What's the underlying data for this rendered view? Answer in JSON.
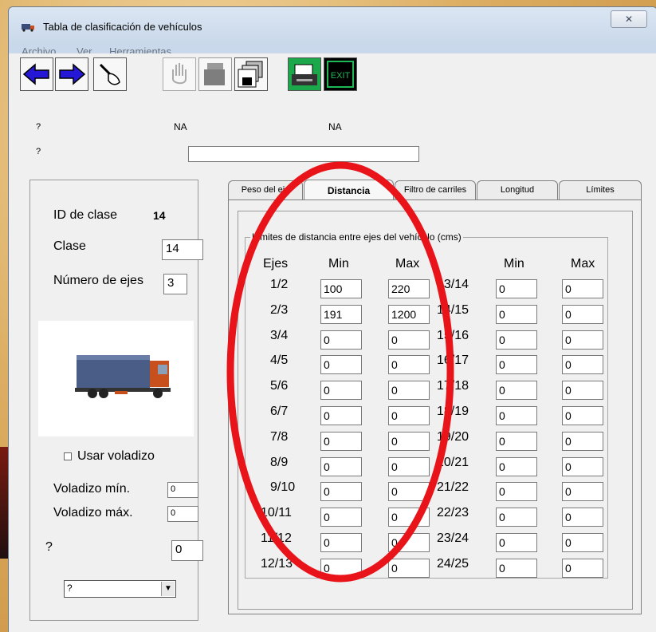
{
  "window": {
    "title": "Tabla de clasificación de vehículos",
    "close_glyph": "✕"
  },
  "menu": [
    "Archivo",
    "Ver",
    "Herramientas"
  ],
  "toolbar": {
    "exit_label": "EXIT",
    "icons": [
      "arrow-left-icon",
      "arrow-right-icon",
      "pen-hand-icon",
      "hand-icon",
      "copy-icon",
      "save-copies-icon",
      "printer-icon",
      "exit-icon"
    ]
  },
  "header": {
    "q1": "?",
    "q2": "?",
    "na1": "NA",
    "na2": "NA",
    "input_value": ""
  },
  "left": {
    "id_label": "ID de clase",
    "id_value": "14",
    "clase_label": "Clase",
    "clase_value": "14",
    "ejes_label": "Número de ejes",
    "ejes_value": "3",
    "usar_voladizo": "Usar voladizo",
    "voladizo_min_label": "Voladizo mín.",
    "voladizo_min_value": "0",
    "voladizo_max_label": "Voladizo máx.",
    "voladizo_max_value": "0",
    "q_label": "?",
    "q_value": "0",
    "select_value": "?"
  },
  "tabs": [
    {
      "label": "Peso del eje",
      "active": false
    },
    {
      "label": "Distancia",
      "active": true
    },
    {
      "label": "Filtro de carriles",
      "active": false
    },
    {
      "label": "Longitud",
      "active": false
    },
    {
      "label": "Límites",
      "active": false
    }
  ],
  "distance": {
    "group_title": "Límites de distancia entre ejes del vehículo (cms)",
    "headers": {
      "ejes": "Ejes",
      "min": "Min",
      "max": "Max",
      "min2": "Min",
      "max2": "Max"
    },
    "left_rows": [
      {
        "label": "1/2",
        "min": "100",
        "max": "220"
      },
      {
        "label": "2/3",
        "min": "191",
        "max": "1200"
      },
      {
        "label": "3/4",
        "min": "0",
        "max": "0"
      },
      {
        "label": "4/5",
        "min": "0",
        "max": "0"
      },
      {
        "label": "5/6",
        "min": "0",
        "max": "0"
      },
      {
        "label": "6/7",
        "min": "0",
        "max": "0"
      },
      {
        "label": "7/8",
        "min": "0",
        "max": "0"
      },
      {
        "label": "8/9",
        "min": "0",
        "max": "0"
      },
      {
        "label": "9/10",
        "min": "0",
        "max": "0"
      },
      {
        "label": "10/11",
        "min": "0",
        "max": "0"
      },
      {
        "label": "11/12",
        "min": "0",
        "max": "0"
      },
      {
        "label": "12/13",
        "min": "0",
        "max": "0"
      }
    ],
    "right_rows": [
      {
        "label": "13/14",
        "min": "0",
        "max": "0"
      },
      {
        "label": "14/15",
        "min": "0",
        "max": "0"
      },
      {
        "label": "15/16",
        "min": "0",
        "max": "0"
      },
      {
        "label": "16/17",
        "min": "0",
        "max": "0"
      },
      {
        "label": "17/18",
        "min": "0",
        "max": "0"
      },
      {
        "label": "18/19",
        "min": "0",
        "max": "0"
      },
      {
        "label": "19/20",
        "min": "0",
        "max": "0"
      },
      {
        "label": "20/21",
        "min": "0",
        "max": "0"
      },
      {
        "label": "21/22",
        "min": "0",
        "max": "0"
      },
      {
        "label": "22/23",
        "min": "0",
        "max": "0"
      },
      {
        "label": "23/24",
        "min": "0",
        "max": "0"
      },
      {
        "label": "24/25",
        "min": "0",
        "max": "0"
      }
    ]
  },
  "annotation": {
    "color": "#e8141a"
  }
}
